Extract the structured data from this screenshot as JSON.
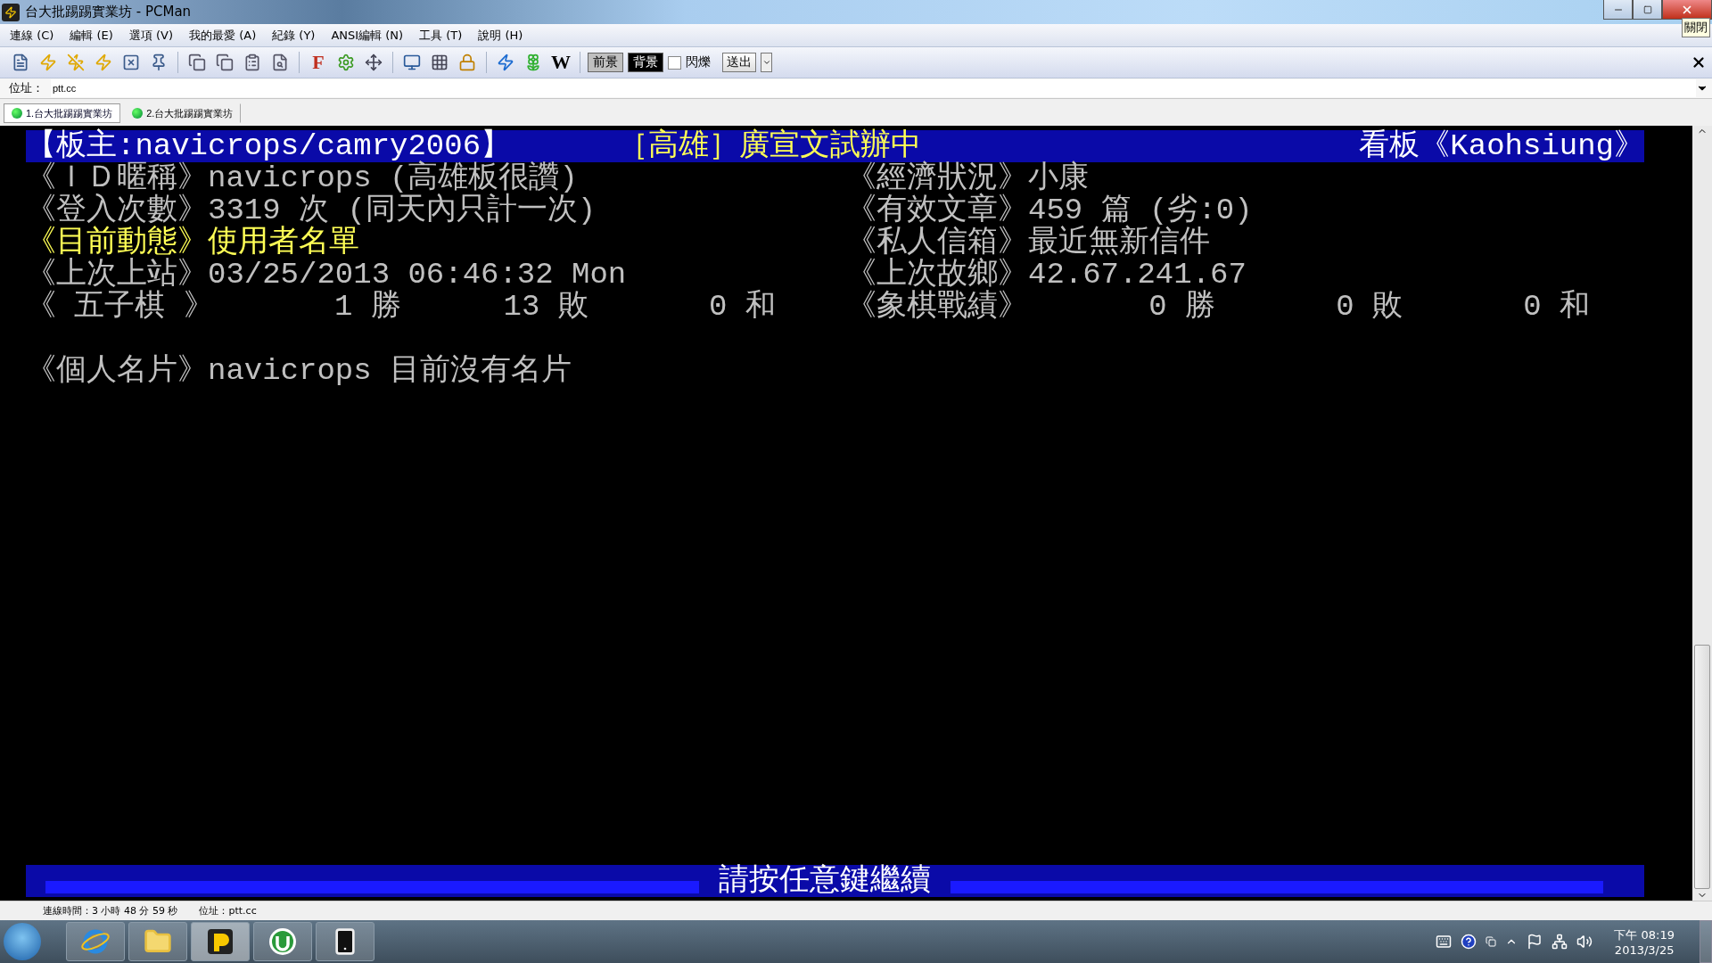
{
  "window": {
    "title": "台大批踢踢實業坊 - PCMan",
    "close_tooltip": "關閉"
  },
  "menu": [
    "連線 (C)",
    "編輯 (E)",
    "選項 (V)",
    "我的最愛 (A)",
    "紀錄 (Y)",
    "ANSI編輯 (N)",
    "工具 (T)",
    "說明 (H)"
  ],
  "toolbar": {
    "letters": [
      "F",
      "W"
    ],
    "colors": [
      {
        "label": "前景",
        "color": "#c0c0c0"
      },
      {
        "label": "背景",
        "color": "#000000"
      }
    ],
    "blink": {
      "label": "閃爍",
      "checked": false
    },
    "send": "送出"
  },
  "address": {
    "label": "位址：",
    "value": "ptt.cc"
  },
  "tabs": [
    {
      "label": "1.台大批踢踢實業坊",
      "selected": true
    },
    {
      "label": "2.台大批踢踢實業坊",
      "selected": false
    }
  ],
  "terminal": {
    "header": {
      "moderator": "【板主:navicrops/camry2006】",
      "notice": "［高雄］廣宣文試辦中",
      "board": "看板《Kaohsiung》"
    },
    "rows": [
      {
        "left": {
          "label": "《ＩＤ暱稱》",
          "value": "navicrops (高雄板很讚)",
          "highlight": false
        },
        "right": {
          "label": "《經濟狀況》",
          "value": "小康",
          "highlight": false
        }
      },
      {
        "left": {
          "label": "《登入次數》",
          "value": "3319 次 (同天內只計一次)",
          "highlight": false
        },
        "right": {
          "label": "《有效文章》",
          "value": "459 篇 (劣:0)",
          "highlight": false
        }
      },
      {
        "left": {
          "label": "《目前動態》",
          "value": "使用者名單",
          "highlight": true
        },
        "right": {
          "label": "《私人信箱》",
          "value": "最近無新信件",
          "highlight": false
        }
      },
      {
        "left": {
          "label": "《上次上站》",
          "value": "03/25/2013 06:46:32 Mon",
          "highlight": false
        },
        "right": {
          "label": "《上次故鄉》",
          "value": "42.67.241.67",
          "highlight": false
        }
      },
      {
        "left": {
          "label": "《 五子棋 》",
          "stats": [
            "1 勝",
            "13 敗",
            "0 和"
          ],
          "highlight": false
        },
        "right": {
          "label": "《象棋戰績》",
          "stats": [
            "0 勝",
            "0 敗",
            "0 和"
          ],
          "highlight": false
        }
      }
    ],
    "card": {
      "label": "《個人名片》",
      "value": "navicrops 目前沒有名片"
    },
    "prompt": "請按任意鍵繼續"
  },
  "status_bar": [
    "連線時間：3 小時 48 分 59 秒",
    "位址：ptt.cc"
  ],
  "taskbar": {
    "time": "下午 08:19",
    "date": "2013/3/25"
  }
}
